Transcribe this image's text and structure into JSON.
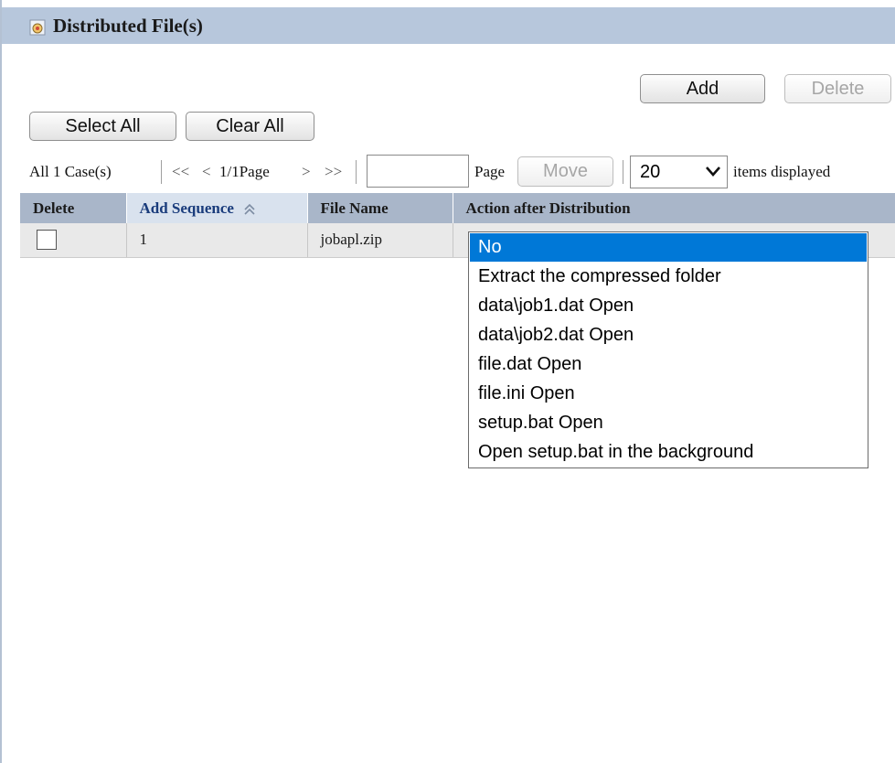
{
  "panel": {
    "title": "Distributed File(s)"
  },
  "toolbar": {
    "add_label": "Add",
    "delete_label": "Delete"
  },
  "selection": {
    "select_all_label": "Select All",
    "clear_all_label": "Clear All"
  },
  "pager": {
    "total": "All 1 Case(s)",
    "first": "<<",
    "prev": "<",
    "current": "1/1Page",
    "next": ">",
    "last": ">>",
    "page_input_value": "",
    "page_label": "Page",
    "move_label": "Move",
    "page_size": "20",
    "items_label": "items displayed"
  },
  "table": {
    "columns": [
      "Delete",
      "Add Sequence",
      "File Name",
      "Action after Distribution"
    ],
    "sorted_column": "Add Sequence",
    "rows": [
      {
        "checked": false,
        "sequence": "1",
        "file_name": "jobapl.zip",
        "action": "No"
      }
    ]
  },
  "action_dropdown": {
    "options": [
      "No",
      "Extract the compressed folder",
      "data\\job1.dat Open",
      "data\\job2.dat Open",
      "file.dat Open",
      "file.ini Open",
      "setup.bat Open",
      "Open setup.bat in the background"
    ],
    "selected": "No"
  },
  "colors": {
    "title_bar": "#b7c7dc",
    "header": "#a9b6c9",
    "sorted_header": "#d9e2ee",
    "selected_option": "#0078d7"
  },
  "icons": {
    "title": "distributed-file-icon",
    "sort": "sort-ascending-icon",
    "select_chevron": "chevron-down-icon"
  }
}
